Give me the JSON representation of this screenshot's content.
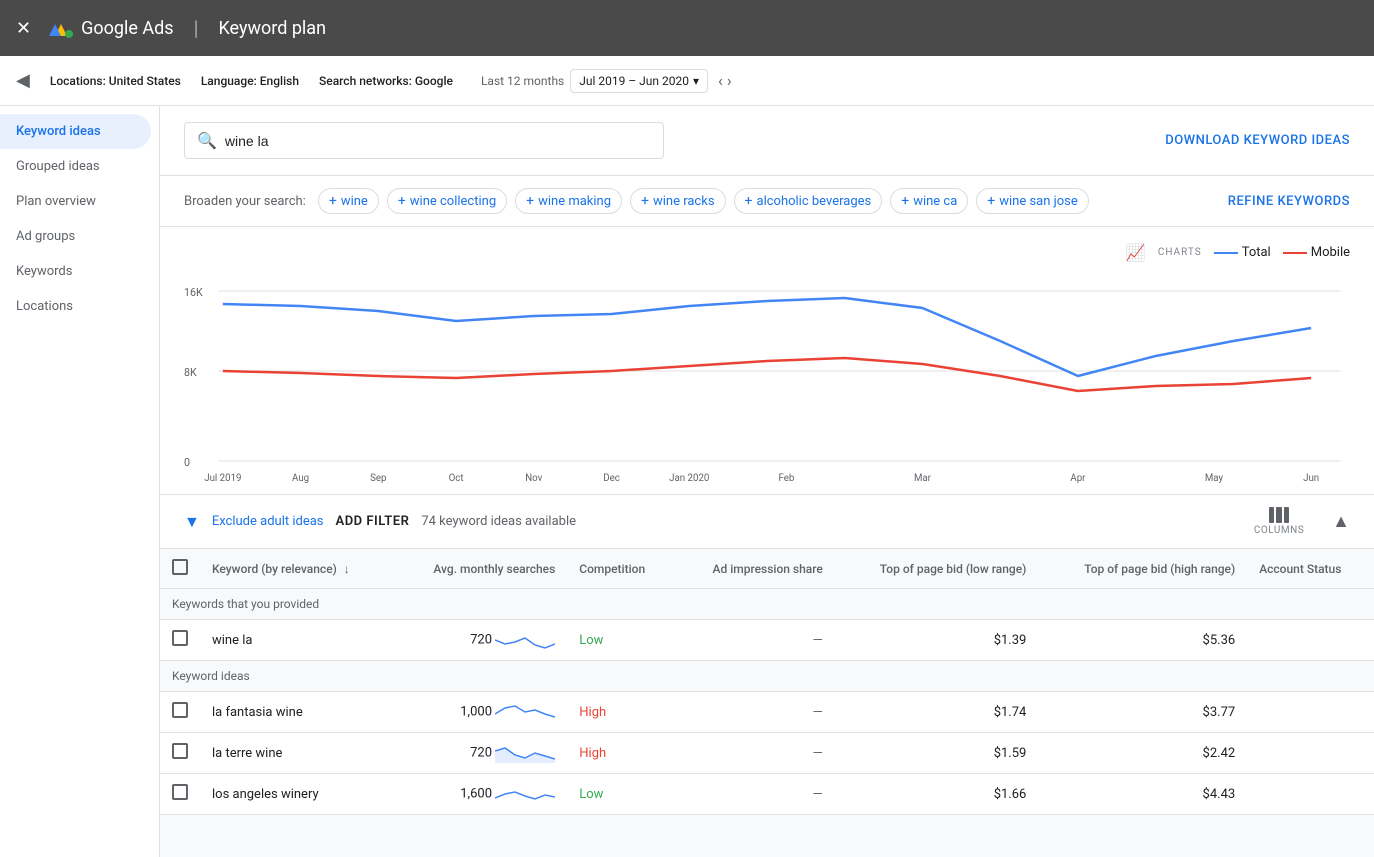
{
  "topbar": {
    "app_name": "Google Ads",
    "page_title": "Keyword plan",
    "close_icon": "×"
  },
  "filter_bar": {
    "toggle_icon": "◀",
    "location_label": "Locations:",
    "location_value": "United States",
    "language_label": "Language:",
    "language_value": "English",
    "network_label": "Search networks:",
    "network_value": "Google",
    "date_label": "Last 12 months",
    "date_value": "Jul 2019 – Jun 2020",
    "prev_arrow": "‹",
    "next_arrow": "›"
  },
  "sidebar": {
    "items": [
      {
        "label": "Keyword ideas",
        "active": true
      },
      {
        "label": "Grouped ideas",
        "active": false
      },
      {
        "label": "Plan overview",
        "active": false
      },
      {
        "label": "Ad groups",
        "active": false
      },
      {
        "label": "Keywords",
        "active": false
      },
      {
        "label": "Locations",
        "active": false
      }
    ]
  },
  "search": {
    "value": "wine la",
    "placeholder": "wine la",
    "download_label": "DOWNLOAD KEYWORD IDEAS"
  },
  "broaden": {
    "label": "Broaden your search:",
    "chips": [
      "wine",
      "wine collecting",
      "wine making",
      "wine racks",
      "alcoholic beverages",
      "wine ca",
      "wine san jose"
    ],
    "refine_label": "REFINE KEYWORDS"
  },
  "chart": {
    "legend": {
      "charts_label": "CHARTS",
      "total_label": "Total",
      "mobile_label": "Mobile"
    },
    "y_labels": [
      "16K",
      "8K",
      "0"
    ],
    "x_labels": [
      "Jul 2019",
      "Aug",
      "Sep",
      "Oct",
      "Nov",
      "Dec",
      "Jan 2020",
      "Feb",
      "Mar",
      "Apr",
      "May",
      "Jun"
    ]
  },
  "table": {
    "toolbar": {
      "exclude_label": "Exclude adult ideas",
      "add_filter_label": "ADD FILTER",
      "ideas_count": "74 keyword ideas available",
      "columns_label": "COLUMNS"
    },
    "headers": [
      "Keyword (by relevance)",
      "Avg. monthly searches",
      "Competition",
      "Ad impression share",
      "Top of page bid (low range)",
      "Top of page bid (high range)",
      "Account Status"
    ],
    "sections": [
      {
        "section_label": "Keywords that you provided",
        "rows": [
          {
            "keyword": "wine la",
            "avg_searches": "720",
            "competition": "Low",
            "competition_class": "comp-low",
            "ad_impression": "—",
            "bid_low": "$1.39",
            "bid_high": "$5.36",
            "status": ""
          }
        ]
      },
      {
        "section_label": "Keyword ideas",
        "rows": [
          {
            "keyword": "la fantasia wine",
            "avg_searches": "1,000",
            "competition": "High",
            "competition_class": "comp-high",
            "ad_impression": "—",
            "bid_low": "$1.74",
            "bid_high": "$3.77",
            "status": ""
          },
          {
            "keyword": "la terre wine",
            "avg_searches": "720",
            "competition": "High",
            "competition_class": "comp-high",
            "ad_impression": "—",
            "bid_low": "$1.59",
            "bid_high": "$2.42",
            "status": ""
          },
          {
            "keyword": "los angeles winery",
            "avg_searches": "1,600",
            "competition": "Low",
            "competition_class": "comp-low",
            "ad_impression": "—",
            "bid_low": "$1.66",
            "bid_high": "$4.43",
            "status": ""
          }
        ]
      }
    ]
  }
}
